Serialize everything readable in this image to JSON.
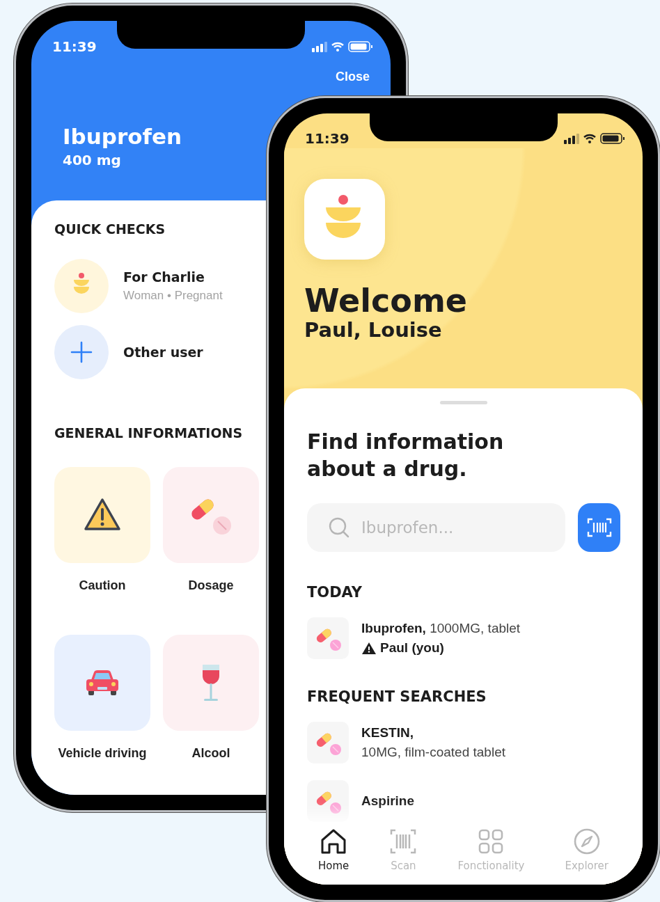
{
  "drug_screen": {
    "status_time": "11:39",
    "close": "Close",
    "drug_name": "Ibuprofen",
    "dose": "400 mg",
    "quick_checks": {
      "title": "QUICK CHECKS",
      "users": [
        {
          "kind": "profile",
          "name": "For Charlie",
          "details": "Woman • Pregnant"
        },
        {
          "kind": "add",
          "name": "Other user"
        }
      ]
    },
    "general": {
      "title": "GENERAL INFORMATIONS",
      "tiles": [
        {
          "kind": "caution",
          "label": "Caution"
        },
        {
          "kind": "dosage",
          "label": "Dosage"
        },
        {
          "kind": "driving",
          "label": "Vehicle driving"
        },
        {
          "kind": "alcohol",
          "label": "Alcool"
        }
      ]
    }
  },
  "home_screen": {
    "status_time": "11:39",
    "title": "Welcome",
    "names": "Paul, Louise",
    "heading": "Find information about a drug.",
    "search": {
      "placeholder": "Ibuprofen..."
    },
    "today": {
      "title": "TODAY",
      "items": [
        {
          "text": "**Ibuprofen,** 1000MG, tablet",
          "warning": "Paul (you)"
        }
      ]
    },
    "frequent": {
      "title": "FREQUENT SEARCHES",
      "items": [
        {
          "name": "KESTIN,",
          "details": "10MG, film-coated tablet"
        },
        {
          "name": "Aspirine"
        }
      ]
    },
    "tabs": [
      {
        "kind": "home",
        "label": "Home",
        "selected": true
      },
      {
        "kind": "scan",
        "label": "Scan",
        "selected": false
      },
      {
        "kind": "grid",
        "label": "Fonctionality",
        "selected": false
      },
      {
        "kind": "compass",
        "label": "Explorer",
        "selected": false
      }
    ]
  }
}
